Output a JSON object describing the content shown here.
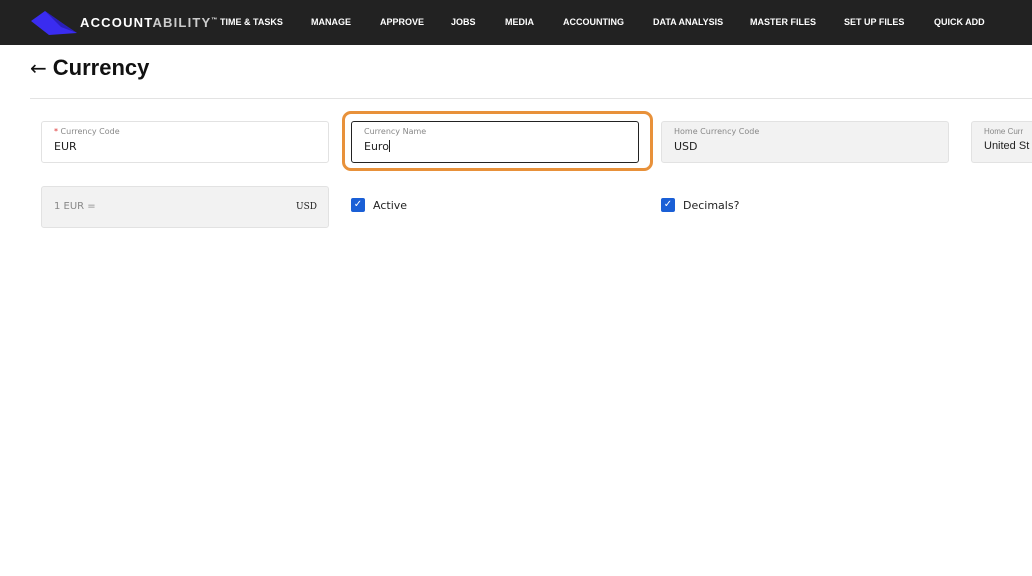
{
  "nav": {
    "brand_bold": "ACCOUNT",
    "brand_light": "ABILITY",
    "brand_tm": "™",
    "items": [
      "TIME & TASKS",
      "MANAGE",
      "APPROVE",
      "JOBS",
      "MEDIA",
      "ACCOUNTING",
      "DATA ANALYSIS",
      "MASTER FILES",
      "SET UP FILES",
      "QUICK ADD"
    ]
  },
  "page": {
    "title": "Currency"
  },
  "form": {
    "currency_code": {
      "label": "Currency Code",
      "required": "*",
      "value": "EUR"
    },
    "currency_name": {
      "label": "Currency Name",
      "value": "Euro"
    },
    "home_currency_code": {
      "label": "Home Currency Code",
      "value": "USD"
    },
    "home_currency_name": {
      "label": "Home Curr",
      "value": "United St"
    },
    "rate": {
      "left": "1 EUR =",
      "right": "USD"
    },
    "active": {
      "label": "Active",
      "checked": true
    },
    "decimals": {
      "label": "Decimals?",
      "checked": true
    }
  },
  "colors": {
    "nav_bg": "#222222",
    "focus": "#e8913a",
    "checkbox": "#1a5fd6",
    "logo": "#3a2cf0"
  }
}
